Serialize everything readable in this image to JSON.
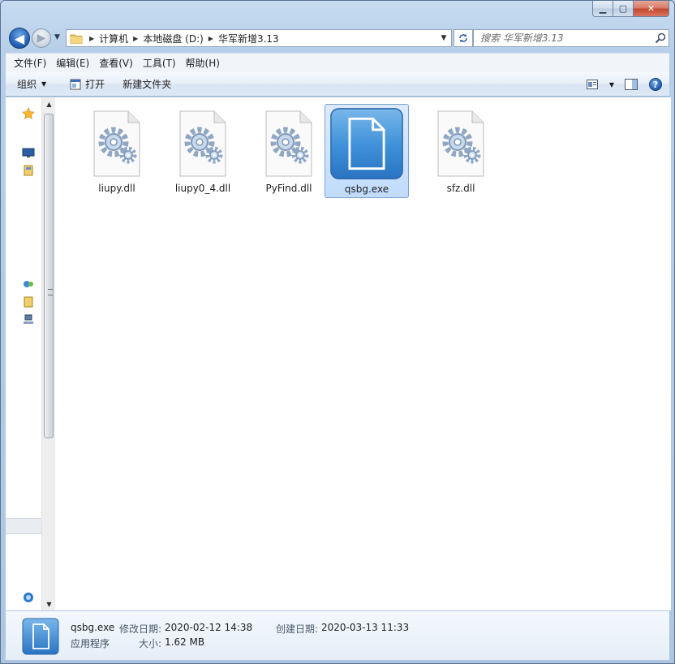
{
  "window": {
    "minimize_glyph": "▁",
    "maximize_glyph": "▢",
    "close_glyph": "✕"
  },
  "navigation": {
    "back_glyph": "◀",
    "forward_glyph": "▶",
    "breadcrumb": [
      "计算机",
      "本地磁盘 (D:)",
      "华军新增3.13"
    ],
    "search_placeholder": "搜索 华军新增3.13"
  },
  "menu": [
    "文件(F)",
    "编辑(E)",
    "查看(V)",
    "工具(T)",
    "帮助(H)"
  ],
  "commands": {
    "organize": "组织",
    "open": "打开",
    "new_folder": "新建文件夹",
    "help_glyph": "?"
  },
  "files": [
    {
      "name": "liupy.dll",
      "type": "dll",
      "selected": false
    },
    {
      "name": "liupy0_4.dll",
      "type": "dll",
      "selected": false
    },
    {
      "name": "PyFind.dll",
      "type": "dll",
      "selected": false
    },
    {
      "name": "qsbg.exe",
      "type": "exe",
      "selected": true
    },
    {
      "name": "sfz.dll",
      "type": "dll",
      "selected": false
    }
  ],
  "details": {
    "name": "qsbg.exe",
    "type": "应用程序",
    "modified_label": "修改日期:",
    "modified_value": "2020-02-12 14:38",
    "created_label": "创建日期:",
    "created_value": "2020-03-13 11:33",
    "size_label": "大小:",
    "size_value": "1.62 MB"
  },
  "colors": {
    "selection": "#c1dcfc",
    "accent": "#2463b8"
  }
}
